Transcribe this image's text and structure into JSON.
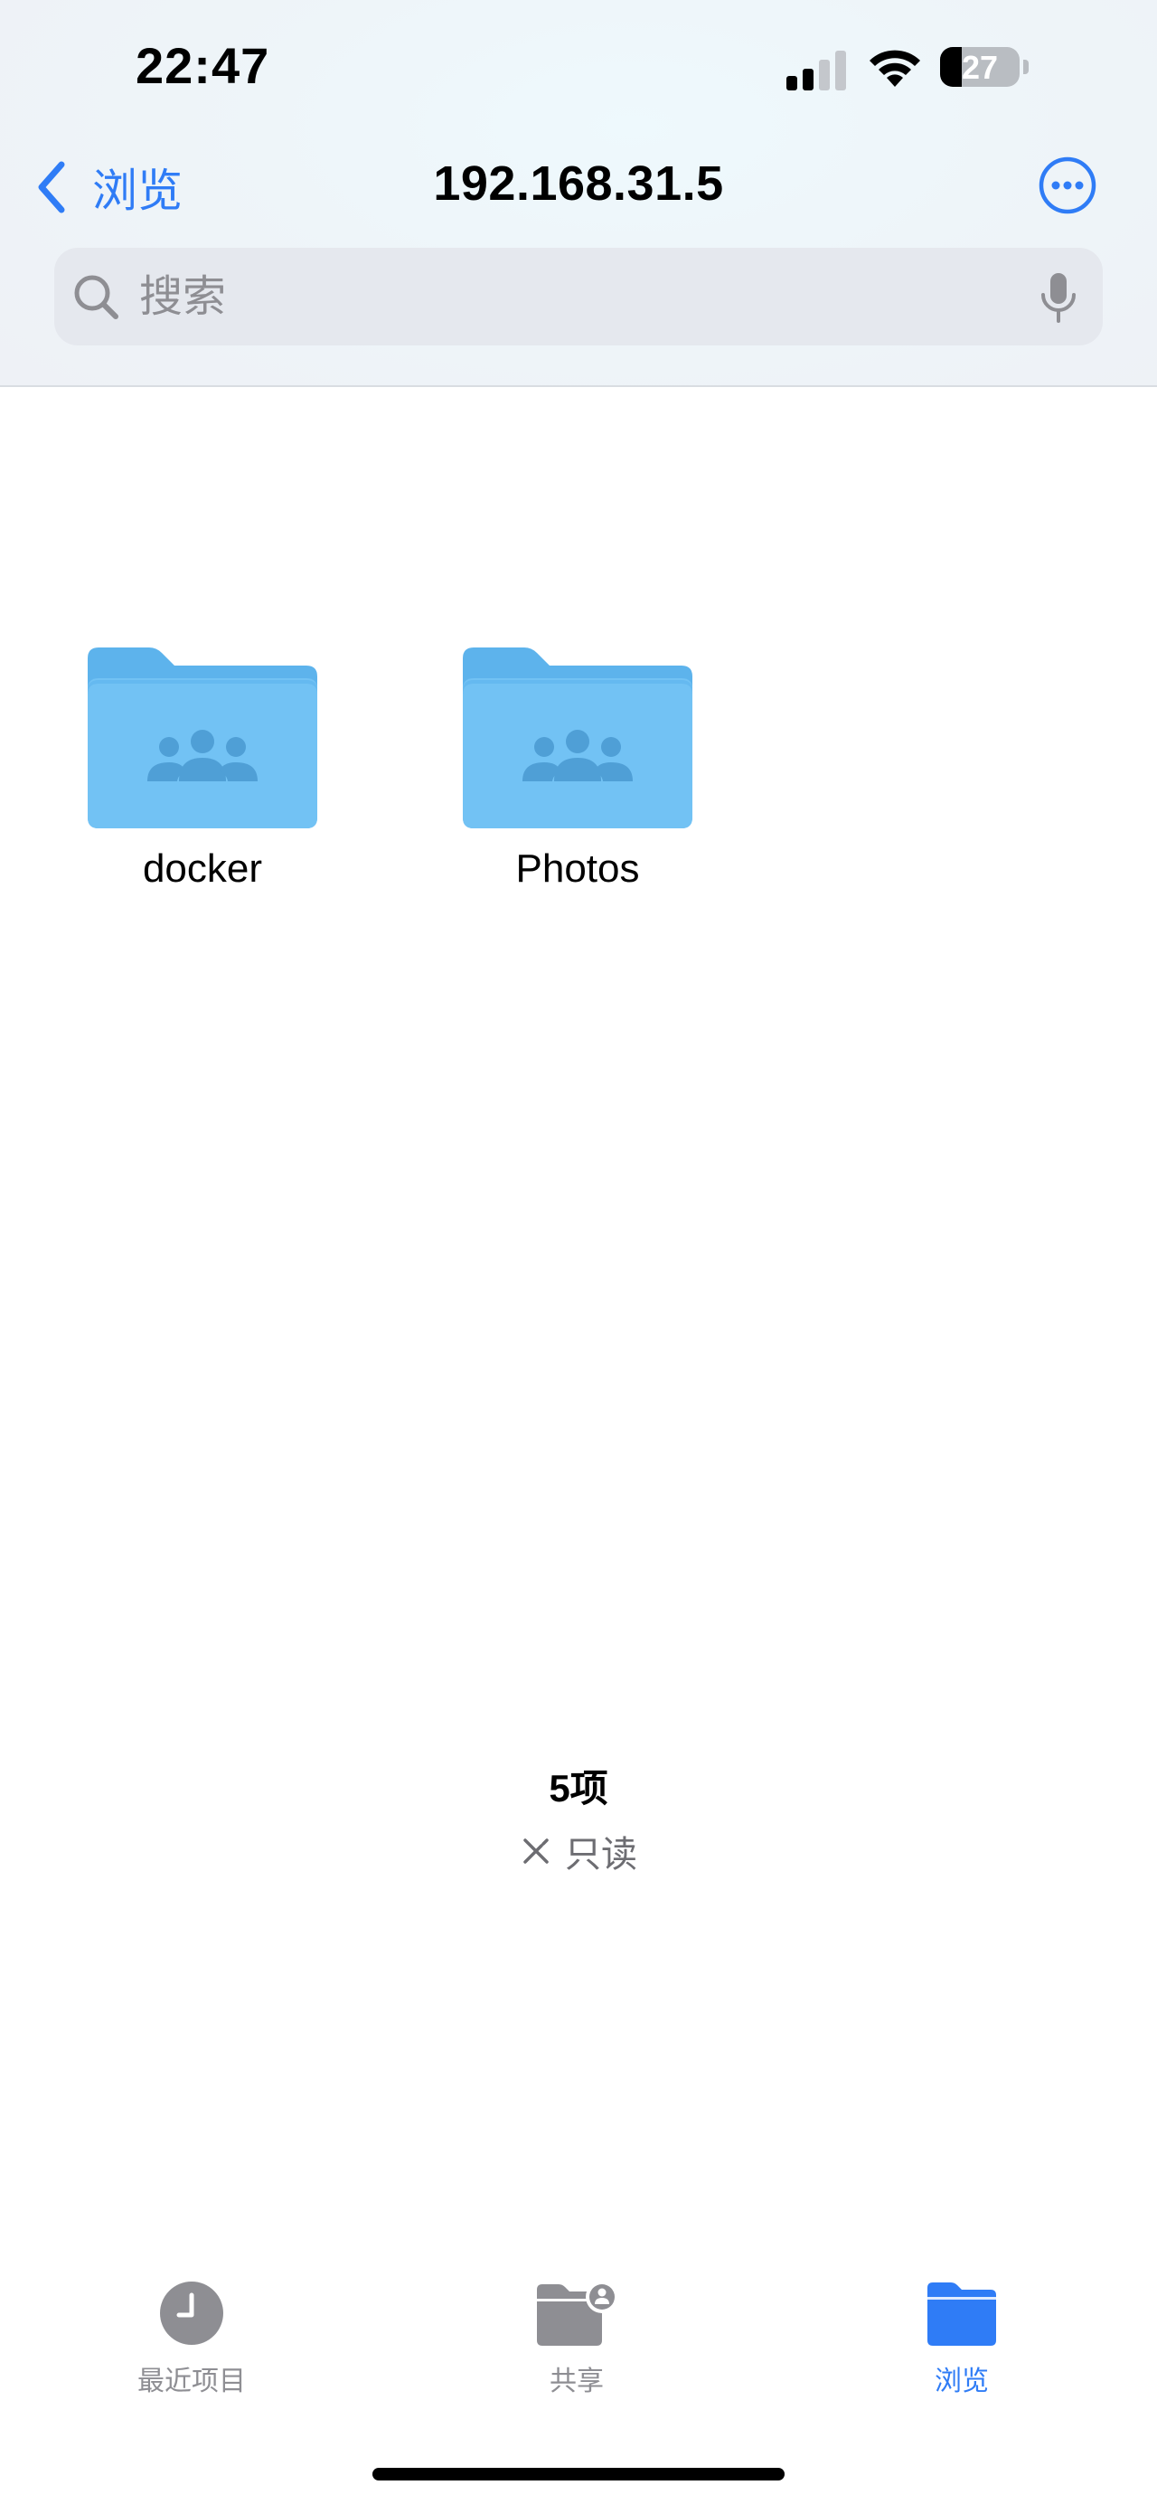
{
  "status_bar": {
    "time": "22:47",
    "battery_percent": "27",
    "battery_level": 0.27,
    "signal_bars_active": 2,
    "signal_bars_total": 4
  },
  "nav": {
    "back_label": "浏览",
    "title": "192.168.31.5",
    "more_icon": "ellipsis-circle-icon"
  },
  "search": {
    "placeholder": "搜索",
    "value": ""
  },
  "folders": [
    {
      "name": "docker",
      "icon": "shared-folder-icon"
    },
    {
      "name": "Photos",
      "icon": "shared-folder-icon"
    }
  ],
  "footer": {
    "item_count": "5项",
    "readonly_label": "只读"
  },
  "tabbar": {
    "tabs": [
      {
        "label": "最近项目",
        "icon": "clock-icon",
        "active": false
      },
      {
        "label": "共享",
        "icon": "shared-folder-icon",
        "active": false
      },
      {
        "label": "浏览",
        "icon": "folder-icon",
        "active": true
      }
    ]
  },
  "colors": {
    "accent": "#2f7cf6",
    "folder_back": "#5db3ec",
    "folder_front": "#6fc0f3",
    "folder_people": "#4f9fd6"
  }
}
